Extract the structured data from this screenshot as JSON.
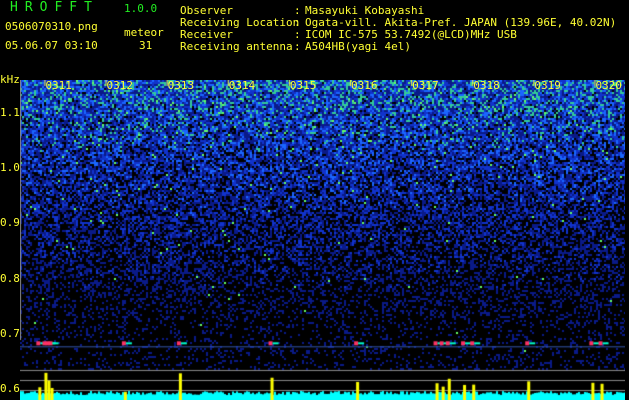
{
  "header": {
    "app_title": "HROFFT",
    "version": "1.0.0",
    "filename": "0506070310.png",
    "datetime": "05.06.07 03:10",
    "meteor_label": "meteor",
    "meteor_count": "31"
  },
  "info": [
    {
      "label": "Observer",
      "value": "Masayuki Kobayashi"
    },
    {
      "label": "Receiving Location",
      "value": "Ogata-vill. Akita-Pref. JAPAN (139.96E, 40.02N)"
    },
    {
      "label": "Receiver",
      "value": "ICOM IC-575 53.7492(@LCD)MHz USB"
    },
    {
      "label": "Receiving antenna",
      "value": "A504HB(yagi 4el)"
    }
  ],
  "colors": {
    "text": "#ffff33",
    "title": "#22ee22",
    "baseline": "#00ffff",
    "meteor": "#ffff00"
  },
  "chart_data": {
    "type": "heatmap",
    "ylabel": "kHz",
    "yticks": [
      "1.1",
      "1.0",
      "0.9",
      "0.8",
      "0.7",
      "0.6"
    ],
    "ylim": [
      0.58,
      1.16
    ],
    "xticks": [
      "0311",
      "0312",
      "0313",
      "0314",
      "0315",
      "0316",
      "0317",
      "0318",
      "0319",
      "0320"
    ],
    "xlim_minutes": [
      10.6,
      20.5
    ],
    "echo_frequency_khz": 0.69,
    "meteor_minutes": [
      10.9,
      11.0,
      11.05,
      11.1,
      12.3,
      13.2,
      14.7,
      16.1,
      17.4,
      17.5,
      17.6,
      17.85,
      18.0,
      18.9,
      19.95,
      20.1
    ]
  }
}
